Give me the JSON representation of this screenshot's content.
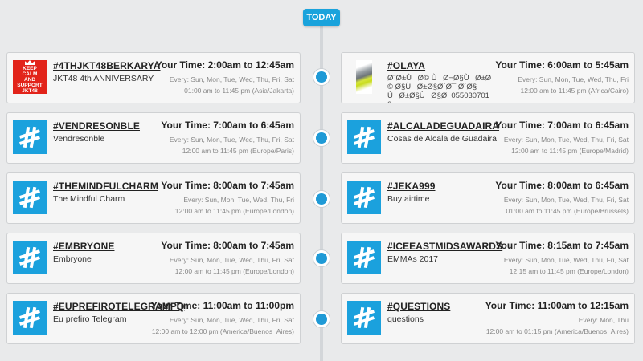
{
  "header": {
    "today_label": "TODAY"
  },
  "left": [
    {
      "tag": "#4THJKT48BERKARYA",
      "desc": "JKT48 4th ANNIVERSARY",
      "your_time": "Your Time: 2:00am to 12:45am",
      "every": "Every: Sun, Mon, Tue, Wed, Thu, Fri, Sat",
      "range": "01:00 am to 11:45 pm (Asia/Jakarta)",
      "thumb": {
        "kind": "keep-calm",
        "lines": [
          "KEEP",
          "CALM",
          "AND",
          "SUPPORT",
          "JKT48"
        ]
      }
    },
    {
      "tag": "#VENDRESONBLE",
      "desc": "Vendresonble",
      "your_time": "Your Time: 7:00am to 6:45am",
      "every": "Every: Sun, Mon, Tue, Wed, Thu, Fri, Sat",
      "range": "12:00 am to 11:45 pm (Europe/Paris)",
      "thumb": {
        "kind": "hashtag"
      }
    },
    {
      "tag": "#THEMINDFULCHARM",
      "desc": "The Mindful Charm",
      "your_time": "Your Time: 8:00am to 7:45am",
      "every": "Every: Sun, Mon, Tue, Wed, Thu, Fri",
      "range": "12:00 am to 11:45 pm (Europe/London)",
      "thumb": {
        "kind": "hashtag"
      }
    },
    {
      "tag": "#EMBRYONE",
      "desc": "Embryone",
      "your_time": "Your Time: 8:00am to 7:45am",
      "every": "Every: Sun, Mon, Tue, Wed, Thu, Fri, Sat",
      "range": "12:00 am to 11:45 pm (Europe/London)",
      "thumb": {
        "kind": "hashtag"
      }
    },
    {
      "tag": "#EUPREFIROTELEGRAMPQ",
      "desc": "Eu prefiro Telegram",
      "your_time": "Your Time: 11:00am to 11:00pm",
      "every": "Every: Sun, Mon, Tue, Wed, Thu, Fri, Sat",
      "range": "12:00 am to 12:00 pm (America/Buenos_Aires)",
      "thumb": {
        "kind": "hashtag"
      }
    }
  ],
  "right": [
    {
      "tag": "#OLAYA",
      "desc": "Ø¨Ø±ÙØ© ÙØ¬Ø§ÙØ±Ø© Ø§ÙØ±Ø§Ø´Ø¯ Ø´Ø§ÙØ±Ø§ÙØ§Ø¦ 0550307010",
      "your_time": "Your Time: 6:00am to 5:45am",
      "every": "Every: Sun, Mon, Tue, Wed, Thu, Fri",
      "range": "12:00 am to 11:45 pm (Africa/Cairo)",
      "thumb": {
        "kind": "photo"
      }
    },
    {
      "tag": "#ALCALADEGUADAIRA",
      "desc": "Cosas de Alcala de Guadaira",
      "your_time": "Your Time: 7:00am to 6:45am",
      "every": "Every: Sun, Mon, Tue, Wed, Thu, Fri, Sat",
      "range": "12:00 am to 11:45 pm (Europe/Madrid)",
      "thumb": {
        "kind": "hashtag"
      }
    },
    {
      "tag": "#JEKA999",
      "desc": "Buy airtime",
      "your_time": "Your Time: 8:00am to 6:45am",
      "every": "Every: Sun, Mon, Tue, Wed, Thu, Fri, Sat",
      "range": "01:00 am to 11:45 pm (Europe/Brussels)",
      "thumb": {
        "kind": "hashtag"
      }
    },
    {
      "tag": "#ICEEASTMIDSAWARDS",
      "desc": "EMMAs 2017",
      "your_time": "Your Time: 8:15am to 7:45am",
      "every": "Every: Sun, Mon, Tue, Wed, Thu, Fri, Sat",
      "range": "12:15 am to 11:45 pm (Europe/London)",
      "thumb": {
        "kind": "hashtag"
      }
    },
    {
      "tag": "#QUESTIONS",
      "desc": "questions",
      "your_time": "Your Time: 11:00am to 12:15am",
      "every": "Every: Mon, Thu",
      "range": "12:00 am to 01:15 pm (America/Buenos_Aires)",
      "thumb": {
        "kind": "hashtag"
      }
    }
  ],
  "colors": {
    "accent": "#1aa3dc",
    "dot": "#1f9ad6",
    "hashtag_bg": "#1ba1dd",
    "keep_calm_red": "#e2231a"
  }
}
